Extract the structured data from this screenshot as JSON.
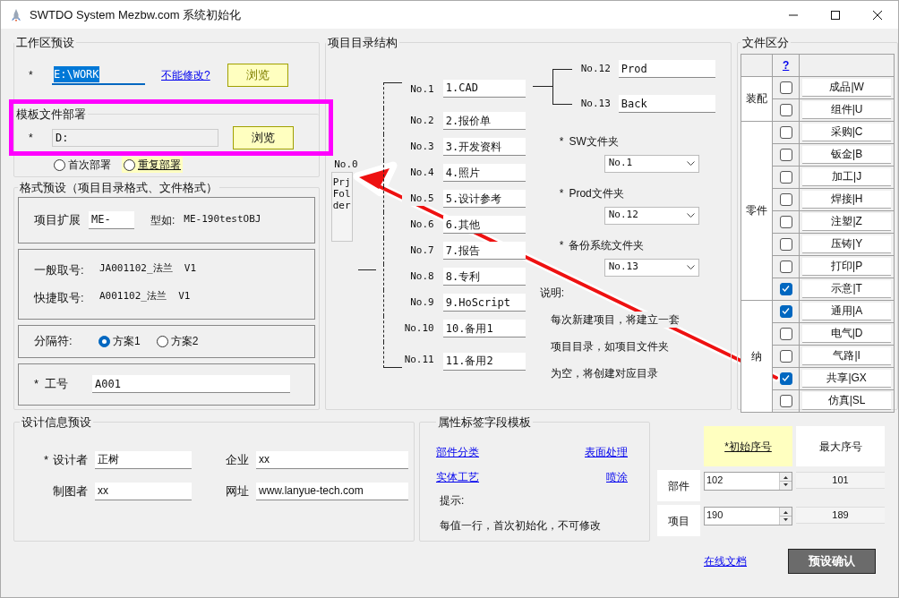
{
  "window": {
    "title": "SWTDO System Mezbw.com 系统初始化"
  },
  "workspace": {
    "title": "工作区预设",
    "required_mark": "*",
    "path": "E:\\WORK",
    "help_link": "不能修改?",
    "browse_button": "浏览",
    "template": {
      "title": "模板文件部署",
      "required_mark": "*",
      "path": "D:",
      "browse_button": "浏览",
      "modes": [
        {
          "label": "首次部署",
          "selected": false,
          "highlighted": false
        },
        {
          "label": "重复部署",
          "selected": false,
          "highlighted": true
        }
      ]
    }
  },
  "format": {
    "title": "格式预设（项目目录格式、文件格式）",
    "ext_label": "项目扩展",
    "ext_value": "ME-",
    "example_label": "型如:",
    "example_value": "ME-190testOBJ",
    "naming": [
      {
        "label": "一般取号:",
        "value": "JA001102_法兰  V1"
      },
      {
        "label": "快捷取号:",
        "value": "A001102_法兰  V1"
      }
    ],
    "separator": {
      "label": "分隔符:",
      "options": [
        {
          "label": "方案1",
          "selected": true
        },
        {
          "label": "方案2",
          "selected": false
        }
      ]
    },
    "job": {
      "required_mark": "*",
      "label": "工号",
      "value": "A001"
    }
  },
  "tree": {
    "title": "项目目录结构",
    "root": {
      "number": "No.0",
      "name": "PrjFolder"
    },
    "children": [
      {
        "number": "No.1",
        "name": "1.CAD",
        "children": [
          {
            "number": "No.12",
            "name": "Prod"
          },
          {
            "number": "No.13",
            "name": "Back"
          }
        ]
      },
      {
        "number": "No.2",
        "name": "2.报价单"
      },
      {
        "number": "No.3",
        "name": "3.开发资料"
      },
      {
        "number": "No.4",
        "name": "4.照片"
      },
      {
        "number": "No.5",
        "name": "5.设计参考"
      },
      {
        "number": "No.6",
        "name": "6.其他"
      },
      {
        "number": "No.7",
        "name": "7.报告"
      },
      {
        "number": "No.8",
        "name": "8.专利"
      },
      {
        "number": "No.9",
        "name": "9.HoScript"
      },
      {
        "number": "No.10",
        "name": "10.备用1"
      },
      {
        "number": "No.11",
        "name": "11.备用2"
      }
    ],
    "folders": [
      {
        "required_mark": "*",
        "label": "SW文件夹",
        "value": "No.1"
      },
      {
        "required_mark": "*",
        "label": "Prod文件夹",
        "value": "No.12"
      },
      {
        "required_mark": "*",
        "label": "备份系统文件夹",
        "value": "No.13"
      }
    ],
    "notes": {
      "title": "说明:",
      "lines": [
        "每次新建项目，将建立一套",
        "项目目录，如项目文件夹",
        "为空，将创建对应目录"
      ]
    }
  },
  "file_types": {
    "title": "文件区分",
    "help_link": "?",
    "groups": [
      {
        "label": "装配",
        "items": [
          {
            "label": "成品|W",
            "checked": false
          },
          {
            "label": "组件|U",
            "checked": false
          }
        ]
      },
      {
        "label": "零件",
        "items": [
          {
            "label": "采购|C",
            "checked": false
          },
          {
            "label": "钣金|B",
            "checked": false
          },
          {
            "label": "加工|J",
            "checked": false
          },
          {
            "label": "焊接|H",
            "checked": false
          },
          {
            "label": "注塑|Z",
            "checked": false
          },
          {
            "label": "压铸|Y",
            "checked": false
          },
          {
            "label": "打印|P",
            "checked": false
          },
          {
            "label": "示意|T",
            "checked": true
          }
        ]
      },
      {
        "label": "纳",
        "items": [
          {
            "label": "通用|A",
            "checked": true
          },
          {
            "label": "电气|D",
            "checked": false
          },
          {
            "label": "气路|I",
            "checked": false
          },
          {
            "label": "共享|GX",
            "checked": true
          },
          {
            "label": "仿真|SL",
            "checked": false
          }
        ]
      }
    ]
  },
  "design_info": {
    "title": "设计信息预设",
    "fields": [
      {
        "required_mark": "*",
        "label": "设计者",
        "value": "正树"
      },
      {
        "label": "企业",
        "value": "xx"
      },
      {
        "label": "制图者",
        "value": "xx"
      },
      {
        "label": "网址",
        "value": "www.lanyue-tech.com"
      }
    ]
  },
  "attribute_template": {
    "title": "属性标签字段模板",
    "links": [
      "部件分类",
      "表面处理",
      "实体工艺",
      "喷涂"
    ],
    "hint_label": "提示:",
    "hint": "每值一行，首次初始化，不可修改"
  },
  "serials": {
    "columns": [
      "*初始序号",
      "最大序号"
    ],
    "rows": [
      {
        "label": "部件",
        "start": "102",
        "max": "101"
      },
      {
        "label": "项目",
        "start": "190",
        "max": "189"
      }
    ]
  },
  "footer": {
    "doc_link": "在线文档",
    "confirm_button": "预设确认"
  }
}
